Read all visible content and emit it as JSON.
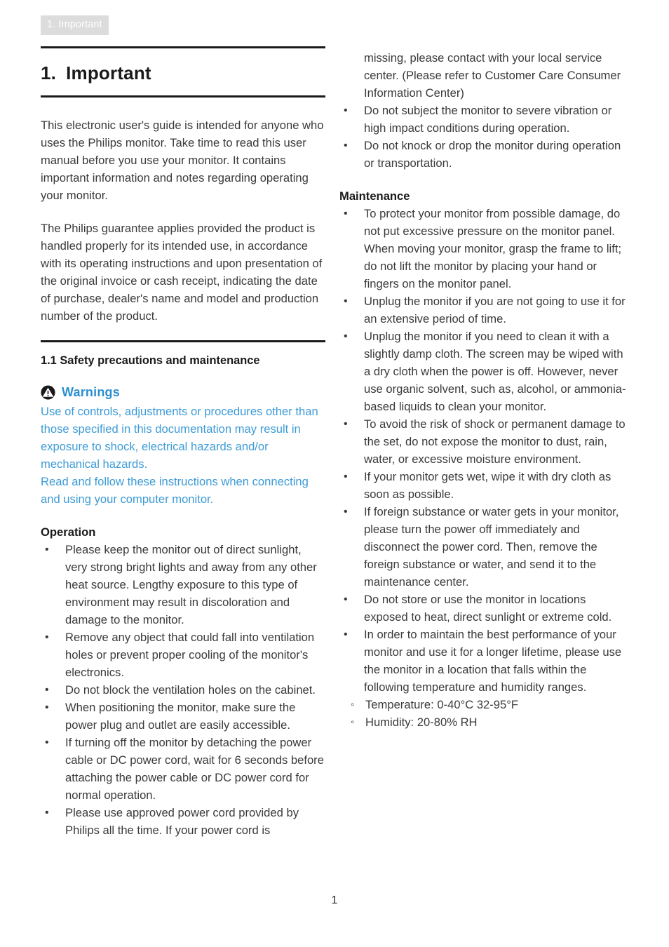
{
  "header": {
    "running_tab": "1. Important"
  },
  "title": {
    "number": "1.",
    "text": "Important"
  },
  "left_column": {
    "intro_paragraph_1": "This electronic user's guide is intended for anyone who uses the Philips monitor. Take time to read this user manual before you use your monitor. It contains important information and notes regarding operating your monitor.",
    "intro_paragraph_2": "The Philips guarantee applies provided the product is handled properly for its intended use, in accordance with its operating instructions and upon presentation of the original invoice or cash receipt, indicating the date of purchase, dealer's name and model and production number of the product.",
    "section_heading": "1.1 Safety precautions and maintenance",
    "warnings": {
      "icon": "warning-triangle-icon",
      "label": "Warnings",
      "line_1": "Use of controls, adjustments or procedures other than those specified in this documentation may result in exposure to shock, electrical hazards and/or mechanical hazards.",
      "line_2": "Read and follow these instructions when connecting and using your computer monitor."
    },
    "operation": {
      "heading": "Operation",
      "items": [
        "Please keep the monitor out of direct sunlight, very strong bright lights and away from any other heat source. Lengthy exposure to this type of environment may result in discoloration and damage to the monitor.",
        "Remove any object that could fall into ventilation holes or prevent proper cooling of the monitor's electronics.",
        "Do not block the ventilation holes on the cabinet.",
        "When positioning the monitor, make sure the power plug and outlet are easily accessible.",
        "If turning off the monitor by detaching the power cable or DC power cord, wait for 6 seconds before attaching the power cable or DC power cord for normal operation.",
        "Please use approved power cord provided by Philips all the time. If your power cord is"
      ]
    }
  },
  "right_column": {
    "continued_item": "missing, please contact with your local service center. (Please refer to Customer Care Consumer Information Center)",
    "operation_continued": [
      "Do not subject the monitor to severe vibration or high impact conditions during operation.",
      "Do not knock or drop the monitor during operation or transportation."
    ],
    "maintenance": {
      "heading": "Maintenance",
      "items": [
        "To protect your monitor from possible damage, do not put excessive pressure on the monitor panel. When moving your monitor, grasp the frame to lift; do not lift the monitor by placing your hand or fingers on the monitor panel.",
        "Unplug the monitor if you are not going to use it for an extensive period of time.",
        "Unplug the monitor if you need to clean it with a slightly damp cloth. The screen may be wiped with a dry cloth when the power is off. However, never use organic solvent, such as, alcohol, or ammonia-based liquids to clean your monitor.",
        "To avoid the risk of shock or permanent damage to the set, do not expose the monitor to dust, rain, water, or excessive moisture environment.",
        "If your monitor gets wet, wipe it with dry cloth as soon as possible.",
        "If foreign substance or water gets in your monitor, please turn the power off immediately and disconnect the power cord. Then, remove the foreign substance or water, and send it to the maintenance center.",
        "Do not store or use the monitor in locations exposed to heat, direct sunlight or extreme cold.",
        "In order to maintain the best performance of your monitor and use it for a longer lifetime, please use the monitor in a location that falls within the following temperature and humidity ranges."
      ],
      "sub_items": [
        "Temperature: 0-40°C 32-95°F",
        "Humidity: 20-80% RH"
      ]
    }
  },
  "footer": {
    "page_number": "1"
  },
  "colors": {
    "warning_blue": "#3d9bd6",
    "warning_label_blue": "#2b8fd0",
    "tab_background": "#dcdcdc",
    "body_text": "#3a3a3a",
    "rule": "#1a1a1a"
  }
}
